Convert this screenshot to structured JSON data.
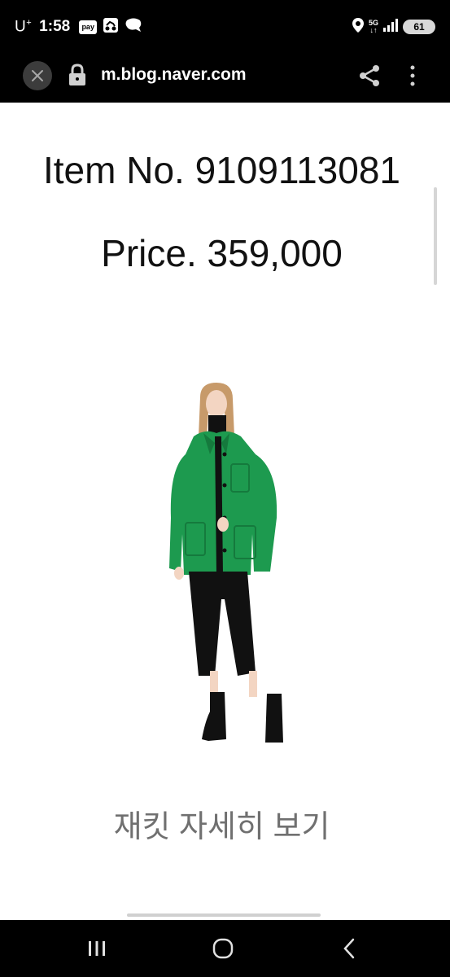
{
  "status_bar": {
    "carrier": "U",
    "carrier_sup": "+",
    "time": "1:58",
    "pay_label": "pay",
    "network": "5G",
    "battery": "61"
  },
  "browser": {
    "url": "m.blog.naver.com"
  },
  "content": {
    "item_no": "Item No. 9109113081",
    "price": "Price. 359,000",
    "detail_link": "재킷 자세히 보기"
  },
  "colors": {
    "jacket": "#1d9a4f",
    "text": "#111111",
    "link_text": "#707070"
  }
}
